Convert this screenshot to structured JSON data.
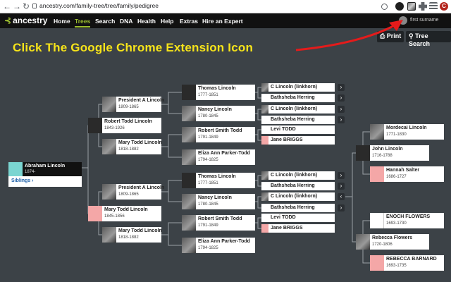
{
  "browser": {
    "url": "ancestry.com/family-tree/tree/family/pedigree",
    "nav_back": "←",
    "nav_forward": "→",
    "reload": "↻",
    "profile_initial": "C"
  },
  "header": {
    "logo": "ancestry",
    "nav": [
      "Home",
      "Trees",
      "Search",
      "DNA",
      "Health",
      "Help",
      "Extras",
      "Hire an Expert"
    ],
    "active": "Trees",
    "user_name": "first surname"
  },
  "toolbar": {
    "print_label": "Print",
    "tree_search_label": "Tree Search"
  },
  "annotation": "Click The Google Chrome Extension Icon",
  "focus_person": {
    "name": "Abraham Lincoln",
    "dates": "1874-",
    "siblings_label": "Siblings ›"
  },
  "gen1": [
    {
      "name": "Robert Todd Lincoln",
      "dates": "1843-1926"
    },
    {
      "name": "Mary Todd Lincoln",
      "dates": "1845-1856"
    }
  ],
  "gen2": [
    {
      "name": "President A Lincoln",
      "dates": "1809-1865"
    },
    {
      "name": "Mary Todd Lincoln",
      "dates": "1818-1882"
    },
    {
      "name": "President A Lincoln",
      "dates": "1809-1865"
    },
    {
      "name": "Mary Todd Lincoln",
      "dates": "1818-1882"
    }
  ],
  "gen3": [
    {
      "name": "Thomas Lincoln",
      "dates": "1777-1851"
    },
    {
      "name": "Nancy Lincoln",
      "dates": "1780-1845"
    },
    {
      "name": "Robert Smith Todd",
      "dates": "1791-1849"
    },
    {
      "name": "Eliza Ann Parker-Todd",
      "dates": "1794-1825"
    },
    {
      "name": "Thomas Lincoln",
      "dates": "1777-1851"
    },
    {
      "name": "Nancy Lincoln",
      "dates": "1780-1845"
    },
    {
      "name": "Robert Smith Todd",
      "dates": "1791-1849"
    },
    {
      "name": "Eliza Ann Parker-Todd",
      "dates": "1794-1825"
    }
  ],
  "gen4": [
    "C Lincoln (linkhorn)",
    "Bathsheba Herring",
    "C Lincoln (linkhorn)",
    "Bathsheba Herring",
    "Levi TODD",
    "Jane BRIGGS",
    "C Lincoln (linkhorn)",
    "Bathsheba Herring",
    "C Lincoln (linkhorn)",
    "Bathsheba Herring",
    "Levi TODD",
    "Jane BRIGGS"
  ],
  "right_tree": [
    {
      "name": "Mordecai Lincoln",
      "dates": "1771-1830"
    },
    {
      "name": "John Lincoln",
      "dates": "1716-1788"
    },
    {
      "name": "Hannah Salter",
      "dates": "1686-1727"
    },
    {
      "name": "ENOCH FLOWERS",
      "dates": "1693-1730"
    },
    {
      "name": "Rebecca Flowers",
      "dates": "1720-1806"
    },
    {
      "name": "REBECCA BARNARD",
      "dates": "1693-1735"
    }
  ],
  "colors": {
    "background": "#3c4247",
    "brand_green": "#9cbe30",
    "annotation_yellow": "#f7e41a",
    "arrow_red": "#e41b1b"
  }
}
